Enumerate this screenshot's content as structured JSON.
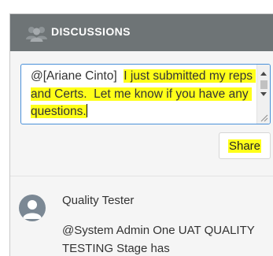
{
  "header": {
    "title": "DISCUSSIONS",
    "icon": "people-group-icon",
    "background": "#6e7476"
  },
  "compose": {
    "mention": "@[Ariane Cinto]",
    "message_highlighted": "I just submitted my reps and Certs.  Let me know if you have any questions.",
    "highlight_color": "#ffff1a",
    "share_label": "Share"
  },
  "feed": {
    "items": [
      {
        "author": "Quality Tester",
        "avatar_icon": "user-avatar-icon",
        "body": "@System Admin One UAT QUALITY TESTING Stage has"
      }
    ]
  }
}
